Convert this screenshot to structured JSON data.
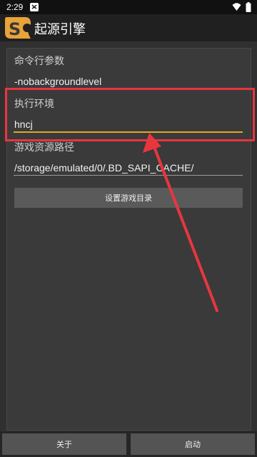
{
  "status_bar": {
    "time": "2:29",
    "icons": [
      "notification-icon",
      "wifi-icon",
      "battery-icon"
    ]
  },
  "app_bar": {
    "logo": "source-engine-logo",
    "title": "起源引擎"
  },
  "form": {
    "args_label": "命令行参数",
    "args_value": "-nobackgroundlevel",
    "env_label": "执行环境",
    "env_value": "hncj",
    "path_label": "游戏资源路径",
    "path_value": "/storage/emulated/0/.BD_SAPI_CACHE/",
    "set_dir_button": "设置游戏目录"
  },
  "bottom_bar": {
    "about_button": "关于",
    "start_button": "启动"
  },
  "colors": {
    "accent": "#e5a623",
    "annotation_red": "#e8363f",
    "background": "#303030"
  }
}
